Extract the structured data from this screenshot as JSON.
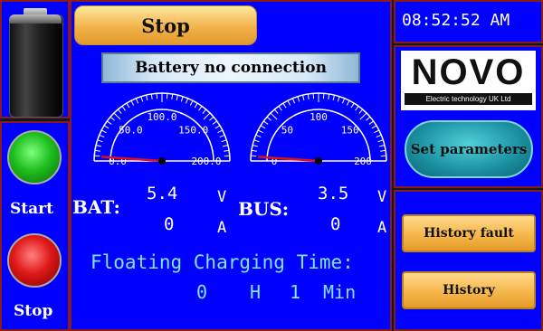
{
  "controls": {
    "stop_button_label": "Stop",
    "start_label": "Start",
    "stop_label": "Stop"
  },
  "status": {
    "message": "Battery no connection"
  },
  "gauges": {
    "battery_gauge": {
      "ticks": [
        "0.0",
        "50.0",
        "100.0",
        "150.0",
        "200.0"
      ],
      "min": 0,
      "max": 200,
      "needle_value": 0
    },
    "bus_gauge": {
      "ticks": [
        "0",
        "50",
        "100",
        "150",
        "200"
      ],
      "min": 0,
      "max": 200,
      "needle_value": 0
    }
  },
  "readings": {
    "bat_label": "BAT:",
    "bat_voltage": "5.4",
    "bat_current": "0",
    "bus_label": "BUS:",
    "bus_voltage": "3.5",
    "bus_current": "0",
    "volt_unit": "V",
    "amp_unit": "A"
  },
  "charging": {
    "title": "Floating Charging Time:",
    "hours": "0",
    "hours_unit": "H",
    "minutes": "1",
    "minutes_unit": "Min"
  },
  "clock": {
    "time": "08:52:52 AM"
  },
  "brand": {
    "logo": "NOVO",
    "tagline": "Electric technology UK Ltd"
  },
  "buttons": {
    "set_parameters": "Set parameters",
    "history_fault": "History  fault",
    "history": "History"
  },
  "colors": {
    "panel_bg": "#0000ff",
    "panel_border": "#8a1b1b",
    "accent_cyan": "#7fe6ff",
    "needle": "#e01010"
  }
}
